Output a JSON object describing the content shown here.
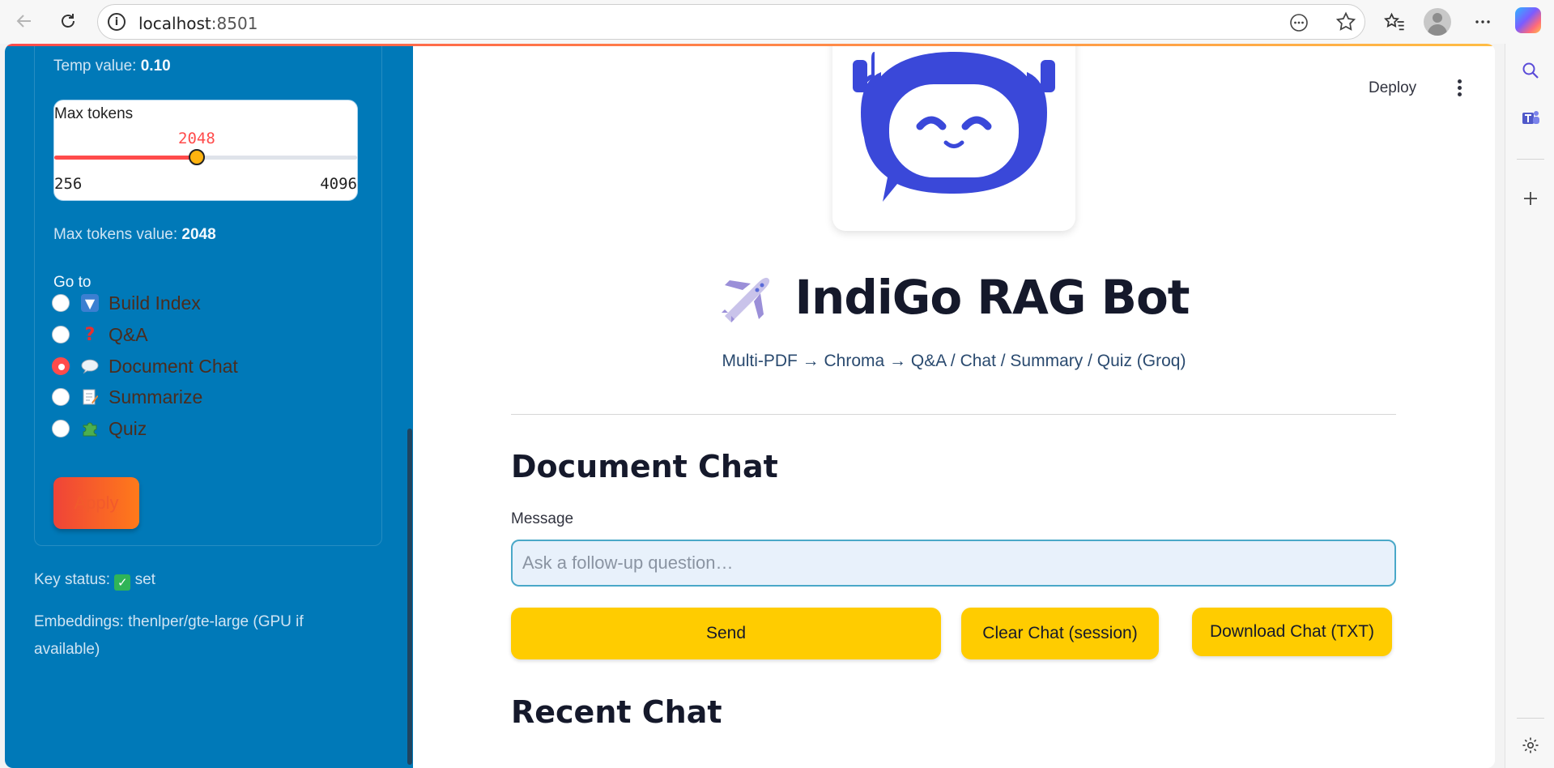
{
  "browser": {
    "url_host": "localhost",
    "url_port": ":8501"
  },
  "sidebar": {
    "temp_label": "Temp value: ",
    "temp_value": "0.10",
    "max_tokens_slider": {
      "label": "Max tokens",
      "value": "2048",
      "min": "256",
      "max": "4096",
      "fraction": 0.4706
    },
    "max_tokens_label": "Max tokens value: ",
    "max_tokens_value": "2048",
    "goto_label": "Go to",
    "nav_options": [
      {
        "label": "Build Index",
        "icon": "inbox-tray-icon",
        "selected": false
      },
      {
        "label": "Q&A",
        "icon": "question-mark-icon",
        "selected": false
      },
      {
        "label": "Document Chat",
        "icon": "speech-balloon-icon",
        "selected": true
      },
      {
        "label": "Summarize",
        "icon": "memo-icon",
        "selected": false
      },
      {
        "label": "Quiz",
        "icon": "puzzle-piece-icon",
        "selected": false
      }
    ],
    "apply_label": "Apply",
    "key_status_label": "Key status: ",
    "key_status_value": "set",
    "embeddings_text": "Embeddings: thenlper/gte-large (GPU if available)"
  },
  "header": {
    "deploy_label": "Deploy"
  },
  "main": {
    "title": "IndiGo RAG Bot",
    "subtitle": "Multi-PDF → Chroma → Q&A / Chat / Summary / Quiz (Groq)",
    "section_title": "Document Chat",
    "message_label": "Message",
    "message_placeholder": "Ask a follow-up question…",
    "send_label": "Send",
    "clear_label": "Clear Chat (session)",
    "download_label": "Download Chat (TXT)",
    "recent_title": "Recent Chat"
  },
  "colors": {
    "sidebar_bg": "#0079b8",
    "accent_red": "#ff4b4b",
    "button_yellow": "#ffcc00",
    "robot_blue": "#3a48d9"
  }
}
